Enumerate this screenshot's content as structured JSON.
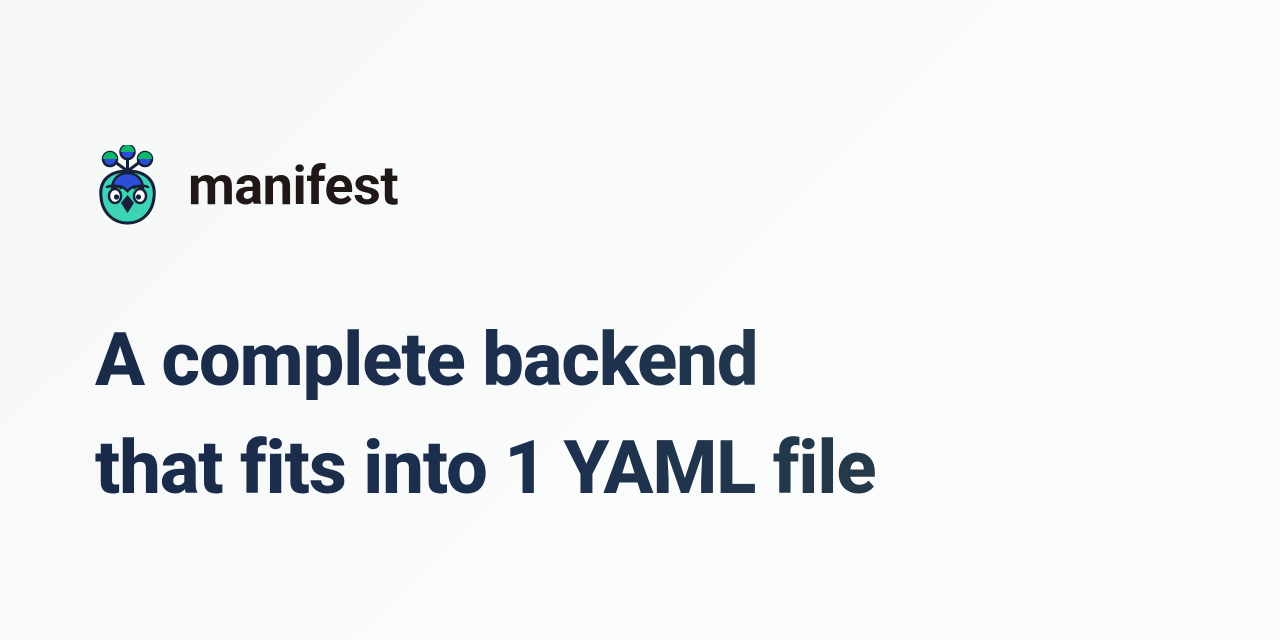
{
  "brand": {
    "name": "manifest"
  },
  "headline": {
    "line1": "A complete backend",
    "line2": "that fits into 1 YAML file"
  },
  "colors": {
    "text_dark": "#1f1816",
    "headline_start": "#1a2b4a",
    "headline_end": "#2c4746",
    "logo_teal": "#3dd4b5",
    "logo_blue": "#2b4fd8",
    "logo_green": "#0bb56a",
    "logo_navy": "#17203a"
  }
}
